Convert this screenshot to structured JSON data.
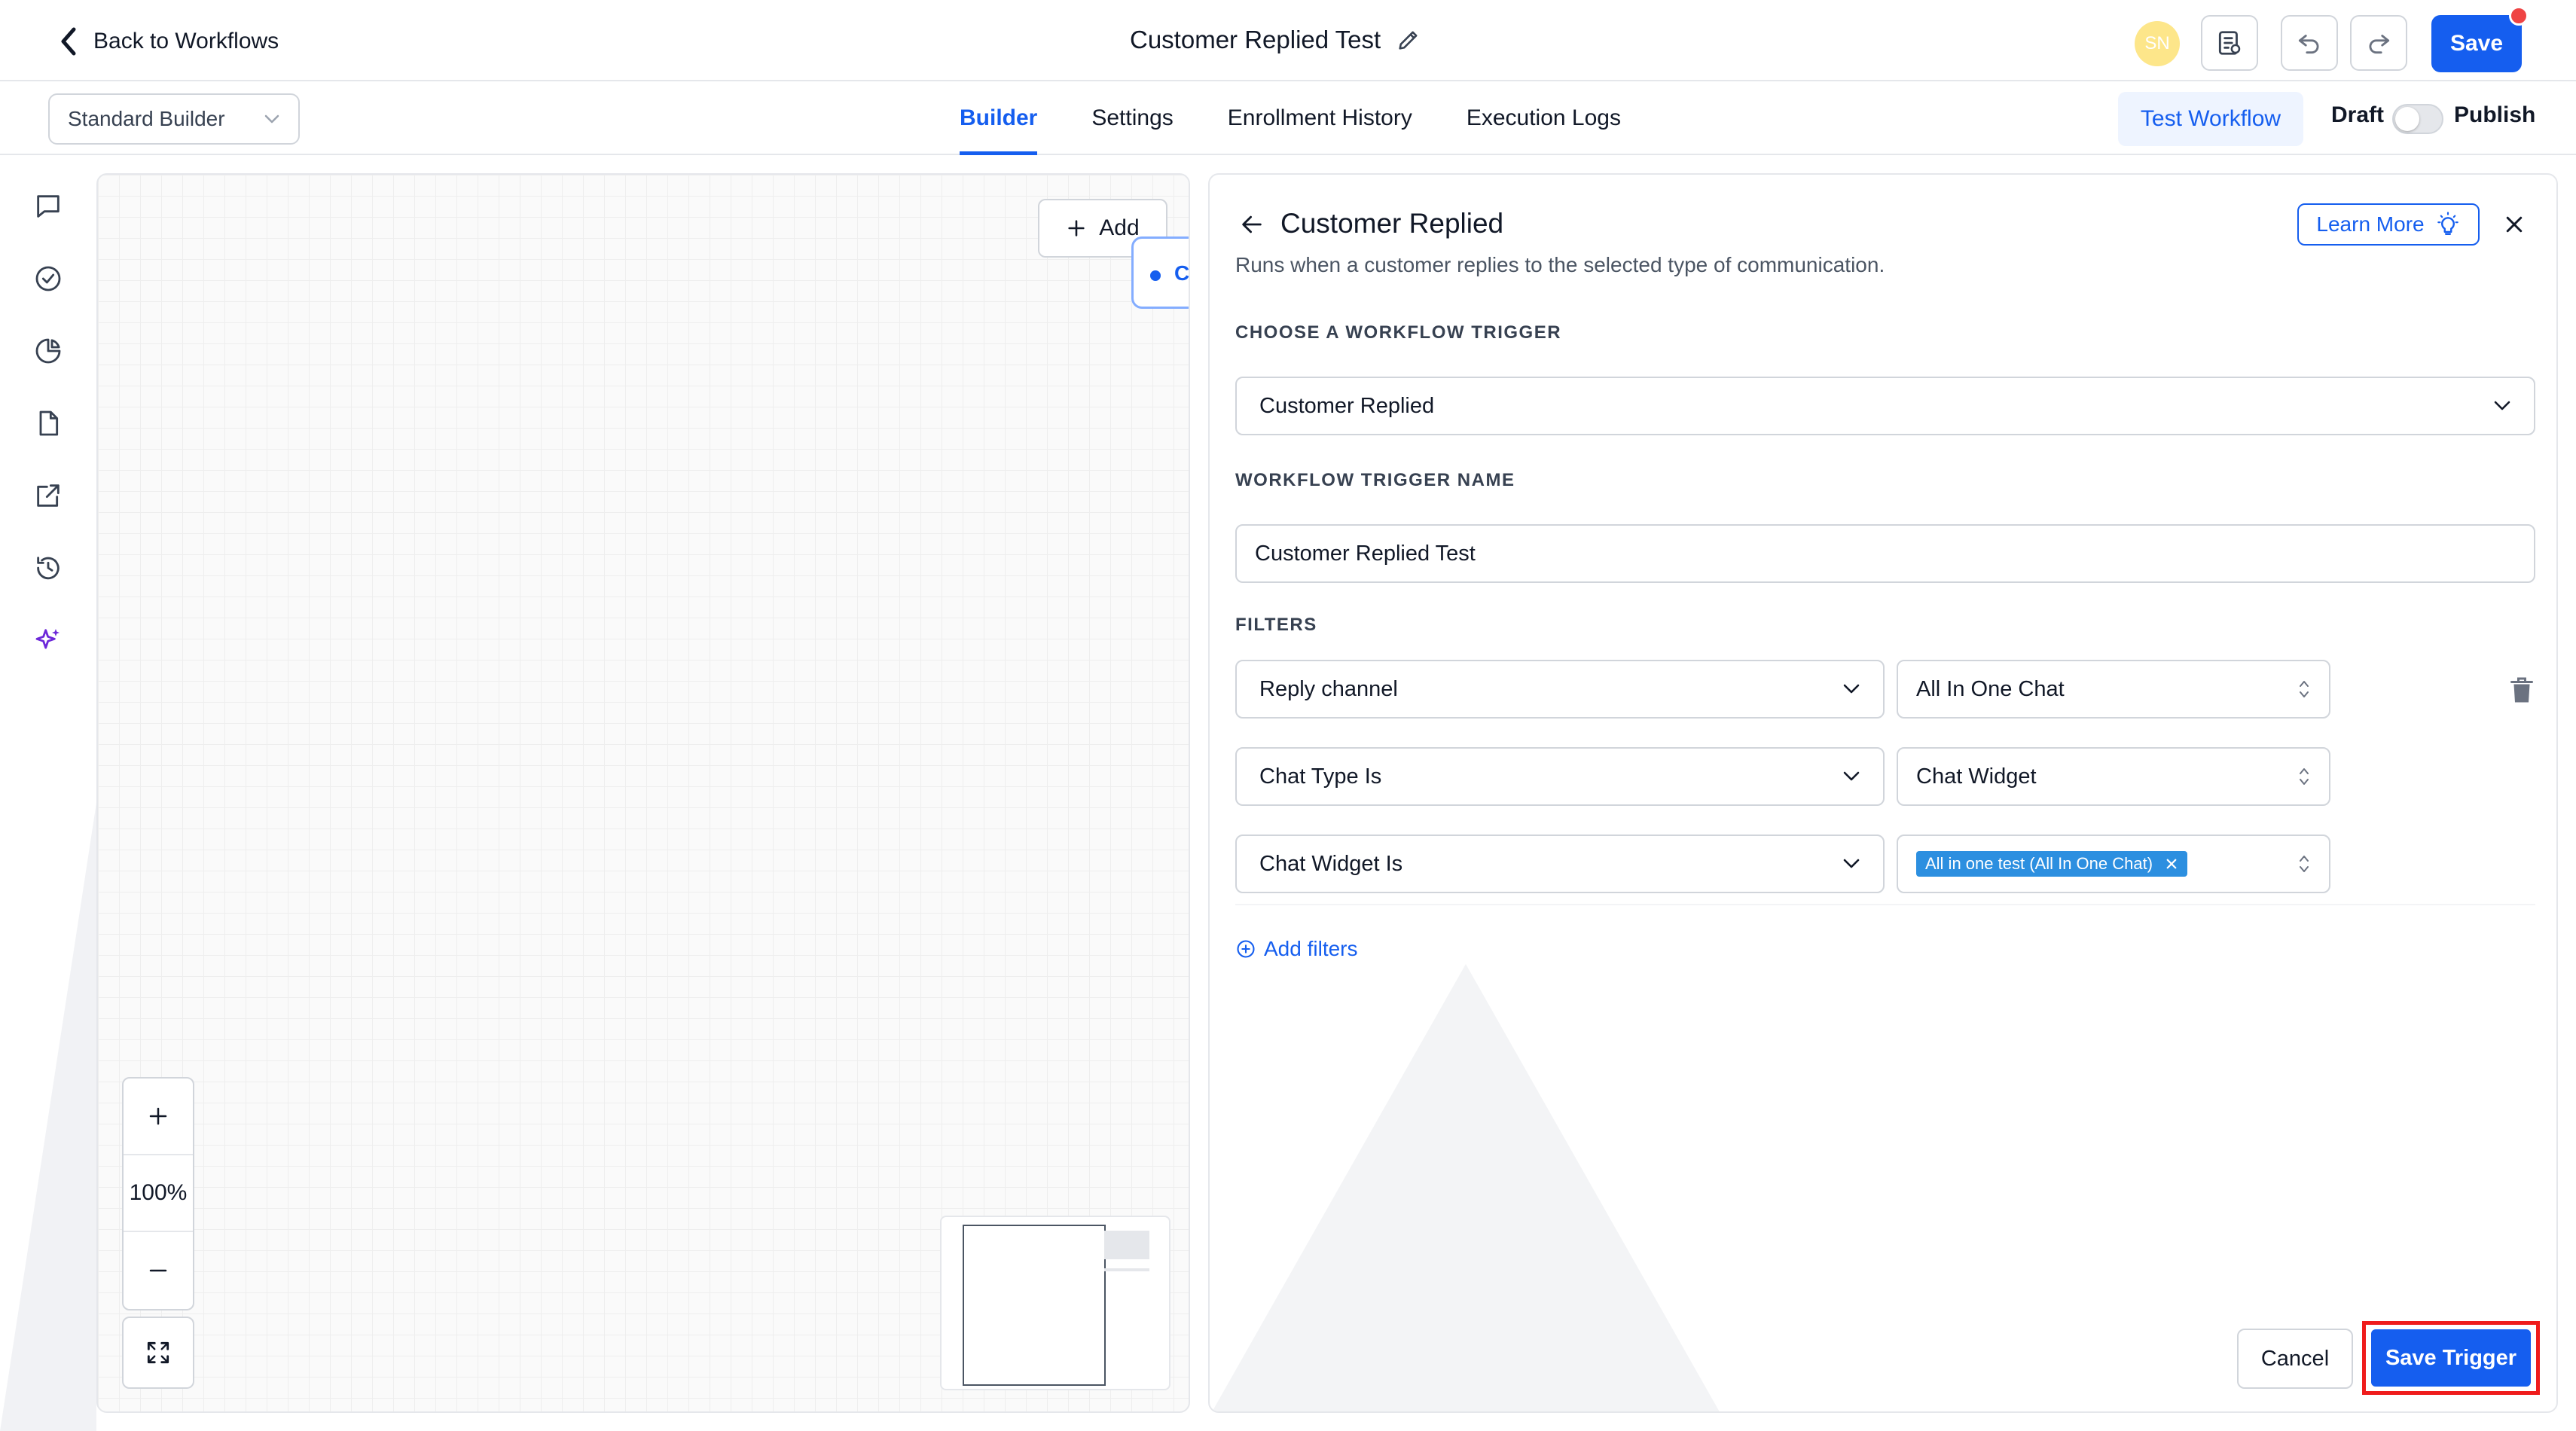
{
  "header": {
    "back_label": "Back to Workflows",
    "workflow_title": "Customer Replied Test",
    "avatar_initials": "SN",
    "save_label": "Save"
  },
  "subbar": {
    "builder_select": "Standard Builder",
    "tabs": [
      {
        "label": "Builder",
        "active": true
      },
      {
        "label": "Settings",
        "active": false
      },
      {
        "label": "Enrollment History",
        "active": false
      },
      {
        "label": "Execution Logs",
        "active": false
      }
    ],
    "test_workflow_label": "Test Workflow",
    "draft_label": "Draft",
    "publish_label": "Publish",
    "publish_enabled": false
  },
  "sidebar": {
    "icons": [
      "chat-bubble-icon",
      "check-circle-icon",
      "pie-chart-icon",
      "document-icon",
      "external-link-icon",
      "history-icon",
      "sparkles-icon"
    ]
  },
  "canvas": {
    "add_label": "Add",
    "trigger_node_initial": "C",
    "zoom_level": "100%"
  },
  "trigger_panel": {
    "title": "Customer Replied",
    "subtitle": "Runs when a customer replies to the selected type of communication.",
    "learn_more_label": "Learn More",
    "choose_trigger_heading": "CHOOSE A WORKFLOW TRIGGER",
    "trigger_selected": "Customer Replied",
    "trigger_name_heading": "WORKFLOW TRIGGER NAME",
    "trigger_name_value": "Customer Replied Test",
    "filters_heading": "FILTERS",
    "filters": [
      {
        "field": "Reply channel",
        "value": "All In One Chat"
      },
      {
        "field": "Chat Type Is",
        "value": "Chat Widget"
      },
      {
        "field": "Chat Widget Is",
        "value_chip": "All in one test (All In One Chat)"
      }
    ],
    "add_filters_label": "Add filters",
    "cancel_label": "Cancel",
    "save_trigger_label": "Save Trigger"
  },
  "colors": {
    "primary": "#155eef",
    "highlight_border": "#ef1c1c",
    "chip": "#2c8fe0",
    "avatar": "#fde68a"
  }
}
